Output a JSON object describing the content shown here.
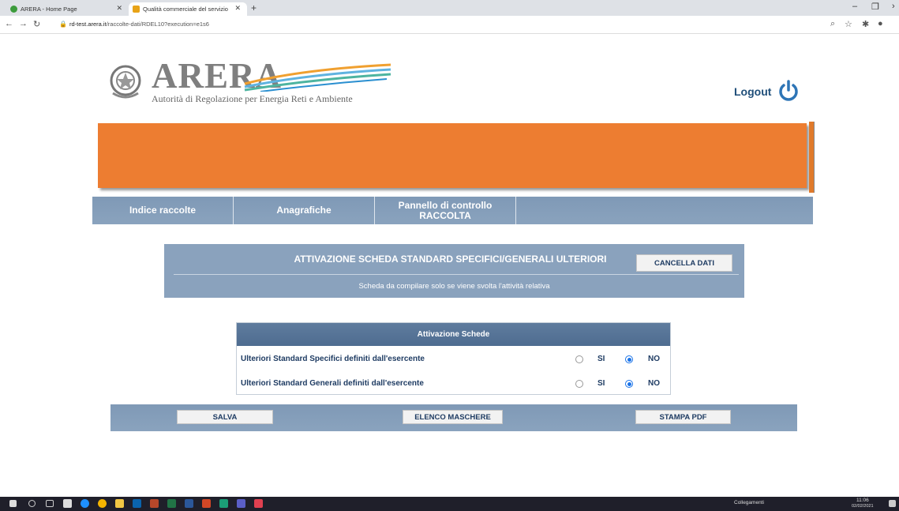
{
  "browser": {
    "tabs": [
      {
        "title": "ARERA - Home Page",
        "favicon_color": "#3c9b3c"
      },
      {
        "title": "Qualità commerciale del servizio",
        "favicon_color": "#e8a317"
      }
    ],
    "url_host": "rd-test.arera.it",
    "url_path": "/raccolte-dati/RDEL10?execution=e1s6"
  },
  "header": {
    "logo": "ARERA",
    "subtitle": "Autorità di Regolazione per Energia Reti e Ambiente",
    "logout_label": "Logout"
  },
  "colors": {
    "banner": "#ed7d31",
    "nav": "#8aa3be",
    "table_head": "#5f7c9e",
    "text_dark": "#1f3c63"
  },
  "nav": {
    "items": [
      "Indice raccolte",
      "Anagrafiche",
      "Pannello di controllo",
      "RACCOLTA"
    ]
  },
  "info": {
    "title": "ATTIVAZIONE SCHEDA STANDARD SPECIFICI/GENERALI ULTERIORI",
    "cancel_label": "CANCELLA DATI",
    "subtitle": "Scheda da compilare solo se viene svolta l'attività relativa"
  },
  "table": {
    "header": "Attivazione Schede",
    "rows": [
      {
        "label": "Ulteriori Standard Specifici definiti dall'esercente",
        "yes": "SI",
        "no": "NO",
        "selected": "NO"
      },
      {
        "label": "Ulteriori Standard Generali definiti dall'esercente",
        "yes": "SI",
        "no": "NO",
        "selected": "NO"
      }
    ]
  },
  "actions": {
    "save": "SALVA",
    "list": "ELENCO MASCHERE",
    "print": "STAMPA PDF"
  },
  "taskbar": {
    "links_label": "Collegamenti",
    "time": "11:06",
    "date": "02/02/2021"
  }
}
